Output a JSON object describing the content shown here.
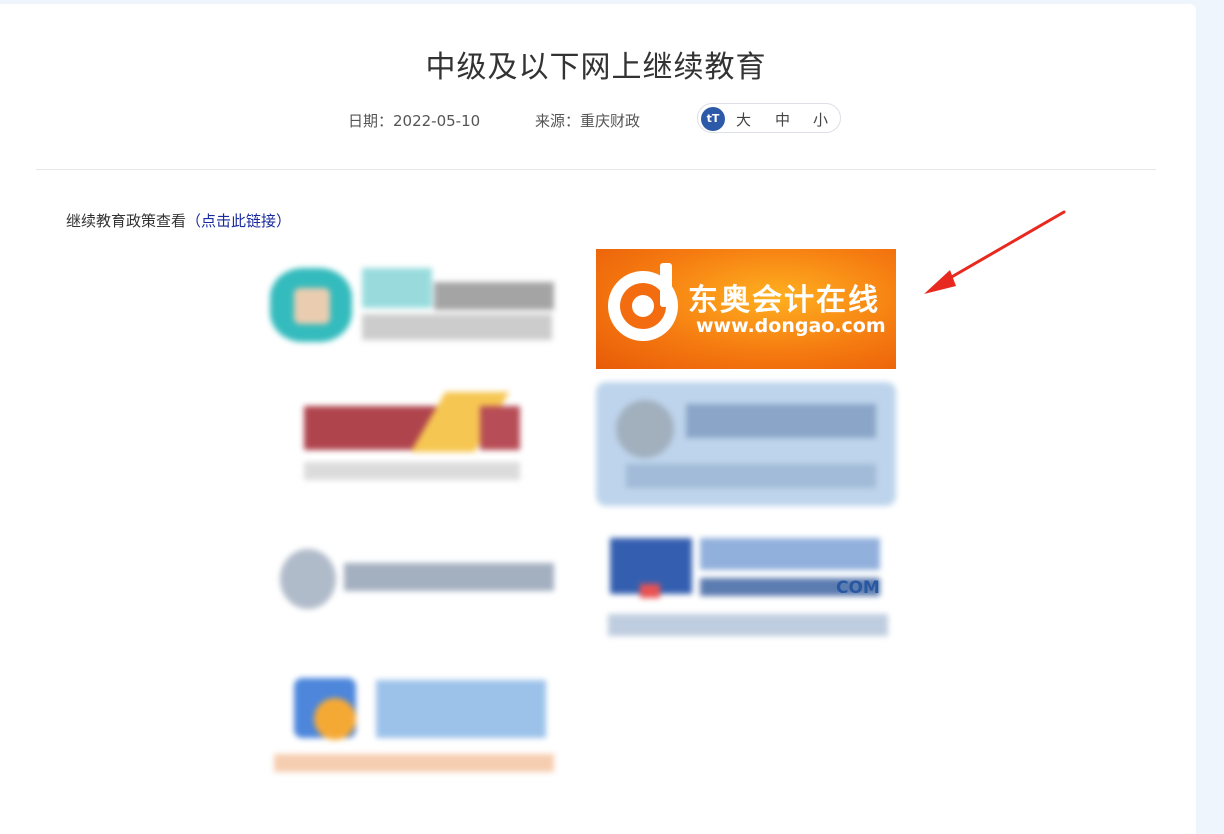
{
  "article": {
    "title": "中级及以下网上继续教育",
    "date": "日期：2022-05-10",
    "source": "来源：重庆财政"
  },
  "font_size_control": {
    "icon": "tT",
    "options": [
      "大",
      "中",
      "小"
    ]
  },
  "policy": {
    "text": "继续教育政策查看",
    "link": "（点击此链接）"
  },
  "logos": {
    "dongao": {
      "name": "东奥会计在线",
      "url": "www.dongao.com"
    },
    "blurred_suffix": "COM"
  },
  "colors": {
    "accent": "#2d5aa8",
    "annotation_arrow": "#e8291f",
    "dongao_orange": "#f57a10"
  }
}
